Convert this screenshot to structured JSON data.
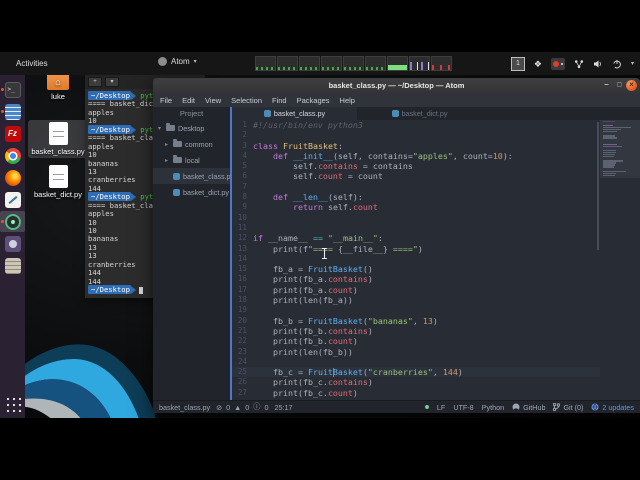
{
  "colors": {
    "accent_pane_blue": "#4d78cc",
    "terminal_prompt_blue": "#2e6db4",
    "terminal_command_green": "#3fd23f",
    "close_button_orange": "#e3571e",
    "dock_running_dot": "#e95420",
    "status_green_dot": "#73c990",
    "updates_blue": "#6494ed",
    "syntax": {
      "comment": "#5c6370",
      "keyword": "#c678dd",
      "class_name": "#e5c07b",
      "function": "#61afef",
      "string": "#98c379",
      "number": "#d19a66",
      "property": "#e06c75",
      "operator": "#56b6c2",
      "text": "#abb2bf"
    }
  },
  "topbar": {
    "activities_label": "Activities",
    "app_menu_label": "Atom",
    "app_menu_caret": "▾",
    "workspace_indicator": "1",
    "dropbox_glyph": "❖",
    "tray_caret": "▾"
  },
  "dock": {
    "items": [
      {
        "name": "terminal",
        "glyph": ">_",
        "running": true,
        "active": false
      },
      {
        "name": "text-editor",
        "glyph": "",
        "running": true,
        "active": false
      },
      {
        "name": "filezilla",
        "glyph": "Fz",
        "running": false,
        "active": false
      },
      {
        "name": "chrome",
        "glyph": "",
        "running": false,
        "active": false
      },
      {
        "name": "firefox",
        "glyph": "",
        "running": false,
        "active": false
      },
      {
        "name": "notes",
        "glyph": "",
        "running": false,
        "active": false
      },
      {
        "name": "atom",
        "glyph": "",
        "running": true,
        "active": true
      },
      {
        "name": "video",
        "glyph": "",
        "running": false,
        "active": false
      },
      {
        "name": "docs",
        "glyph": "",
        "running": false,
        "active": false
      }
    ]
  },
  "desktop_icons": [
    {
      "label": "luke",
      "type": "folder",
      "glyph": "⌂",
      "selected": false
    },
    {
      "label": "basket_class.py",
      "type": "file",
      "glyph": "",
      "selected": true
    },
    {
      "label": "basket_dict.py",
      "type": "file",
      "glyph": "",
      "selected": false
    }
  ],
  "terminal": {
    "new_tab_glyph": "+",
    "dropdown_glyph": "▾",
    "prompt": "~/Desktop",
    "lines": [
      {
        "prompt": true,
        "command": "pyt"
      },
      {
        "output": "==== basket_dict"
      },
      {
        "output": "apples"
      },
      {
        "output": "10"
      },
      {
        "prompt": true,
        "command": "pyt"
      },
      {
        "output": "==== basket_clas"
      },
      {
        "output": "apples"
      },
      {
        "output": "10"
      },
      {
        "output": "bananas"
      },
      {
        "output": "13"
      },
      {
        "output": "cranberries"
      },
      {
        "output": "144"
      },
      {
        "prompt": true,
        "command": "pyt"
      },
      {
        "output": "==== basket_clas"
      },
      {
        "output": "apples"
      },
      {
        "output": "10"
      },
      {
        "output": "10"
      },
      {
        "output": "bananas"
      },
      {
        "output": "13"
      },
      {
        "output": "13"
      },
      {
        "output": "cranberries"
      },
      {
        "output": "144"
      },
      {
        "output": "144"
      },
      {
        "prompt": true,
        "command": "",
        "cursor": true
      }
    ]
  },
  "atom": {
    "window_title": "basket_class.py — ~/Desktop — Atom",
    "minimize_glyph": "–",
    "maximize_glyph": "▢",
    "close_glyph": "×",
    "menus": [
      "File",
      "Edit",
      "View",
      "Selection",
      "Find",
      "Packages",
      "Help"
    ],
    "project": {
      "header": "Project",
      "items": [
        {
          "label": "Desktop",
          "type": "folder",
          "chevron": "▾",
          "indent": 0,
          "selected": false
        },
        {
          "label": "common",
          "type": "folder",
          "chevron": "▸",
          "indent": 1,
          "selected": false
        },
        {
          "label": "local",
          "type": "folder",
          "chevron": "▸",
          "indent": 1,
          "selected": false
        },
        {
          "label": "basket_class.py",
          "type": "python-file",
          "chevron": "",
          "indent": 1,
          "selected": true
        },
        {
          "label": "basket_dict.py",
          "type": "python-file",
          "chevron": "",
          "indent": 1,
          "selected": false
        }
      ]
    },
    "tabs": [
      {
        "label": "basket_class.py",
        "active": true
      },
      {
        "label": "basket_dict.py",
        "active": false
      }
    ],
    "editor": {
      "cursor": {
        "line": 25,
        "column": 17
      },
      "lines": [
        {
          "n": 1,
          "tokens": [
            [
              "c",
              "#!/usr/bin/env python3"
            ]
          ]
        },
        {
          "n": 2,
          "tokens": []
        },
        {
          "n": 3,
          "tokens": [
            [
              "k",
              "class "
            ],
            [
              "cl",
              "FruitBasket"
            ],
            [
              "t",
              ":"
            ]
          ]
        },
        {
          "n": 4,
          "tokens": [
            [
              "t",
              "    "
            ],
            [
              "k",
              "def "
            ],
            [
              "fn",
              "__init__"
            ],
            [
              "t",
              "(self, contains="
            ],
            [
              "s",
              "\"apples\""
            ],
            [
              "t",
              ", count="
            ],
            [
              "n2",
              "10"
            ],
            [
              "t",
              "):"
            ]
          ]
        },
        {
          "n": 5,
          "tokens": [
            [
              "t",
              "        self."
            ],
            [
              "p",
              "contains"
            ],
            [
              "t",
              " = contains"
            ]
          ]
        },
        {
          "n": 6,
          "tokens": [
            [
              "t",
              "        self."
            ],
            [
              "p",
              "count"
            ],
            [
              "t",
              " = count"
            ]
          ]
        },
        {
          "n": 7,
          "tokens": []
        },
        {
          "n": 8,
          "tokens": [
            [
              "t",
              "    "
            ],
            [
              "k",
              "def "
            ],
            [
              "fn",
              "__len__"
            ],
            [
              "t",
              "(self):"
            ]
          ]
        },
        {
          "n": 9,
          "tokens": [
            [
              "t",
              "        "
            ],
            [
              "k",
              "return"
            ],
            [
              "t",
              " self."
            ],
            [
              "p",
              "count"
            ]
          ]
        },
        {
          "n": 10,
          "tokens": []
        },
        {
          "n": 11,
          "tokens": []
        },
        {
          "n": 12,
          "tokens": [
            [
              "k",
              "if "
            ],
            [
              "t",
              "__name__ "
            ],
            [
              "o",
              "=="
            ],
            [
              "t",
              " "
            ],
            [
              "s",
              "\"__main__\""
            ],
            [
              "t",
              ":"
            ]
          ]
        },
        {
          "n": 13,
          "tokens": [
            [
              "t",
              "    print(f"
            ],
            [
              "s",
              "\"==== "
            ],
            [
              "t",
              "{__file__}"
            ],
            [
              "s",
              " ====\""
            ],
            [
              "t",
              ")"
            ]
          ]
        },
        {
          "n": 14,
          "tokens": []
        },
        {
          "n": 15,
          "tokens": [
            [
              "t",
              "    fb_a = "
            ],
            [
              "fn",
              "FruitBasket"
            ],
            [
              "t",
              "()"
            ]
          ]
        },
        {
          "n": 16,
          "tokens": [
            [
              "t",
              "    print(fb_a."
            ],
            [
              "p",
              "contains"
            ],
            [
              "t",
              ")"
            ]
          ]
        },
        {
          "n": 17,
          "tokens": [
            [
              "t",
              "    print(fb_a."
            ],
            [
              "p",
              "count"
            ],
            [
              "t",
              ")"
            ]
          ]
        },
        {
          "n": 18,
          "tokens": [
            [
              "t",
              "    print(len(fb_a))"
            ]
          ]
        },
        {
          "n": 19,
          "tokens": []
        },
        {
          "n": 20,
          "tokens": [
            [
              "t",
              "    fb_b = "
            ],
            [
              "fn",
              "FruitBasket"
            ],
            [
              "t",
              "("
            ],
            [
              "s",
              "\"bananas\""
            ],
            [
              "t",
              ", "
            ],
            [
              "n2",
              "13"
            ],
            [
              "t",
              ")"
            ]
          ]
        },
        {
          "n": 21,
          "tokens": [
            [
              "t",
              "    print(fb_b."
            ],
            [
              "p",
              "contains"
            ],
            [
              "t",
              ")"
            ]
          ]
        },
        {
          "n": 22,
          "tokens": [
            [
              "t",
              "    print(fb_b."
            ],
            [
              "p",
              "count"
            ],
            [
              "t",
              ")"
            ]
          ]
        },
        {
          "n": 23,
          "tokens": [
            [
              "t",
              "    print(len(fb_b))"
            ]
          ]
        },
        {
          "n": 24,
          "tokens": []
        },
        {
          "n": 25,
          "tokens": [
            [
              "t",
              "    fb_c = "
            ],
            [
              "fn",
              "FruitBasket"
            ],
            [
              "t",
              "("
            ],
            [
              "s",
              "\"cranberries\""
            ],
            [
              "t",
              ", "
            ],
            [
              "n2",
              "144"
            ],
            [
              "t",
              ")"
            ]
          ]
        },
        {
          "n": 26,
          "tokens": [
            [
              "t",
              "    print(fb_c."
            ],
            [
              "p",
              "contains"
            ],
            [
              "t",
              ")"
            ]
          ]
        },
        {
          "n": 27,
          "tokens": [
            [
              "t",
              "    print(fb_c."
            ],
            [
              "p",
              "count"
            ],
            [
              "t",
              ")"
            ]
          ]
        }
      ]
    },
    "statusbar": {
      "file": "basket_class.py",
      "errors_icon": "⊘",
      "errors": "0",
      "warnings_icon": "▲",
      "warnings": "0",
      "info_icon": "ⓘ",
      "info": "0",
      "cursor_position": "25:17",
      "line_ending": "LF",
      "encoding": "UTF-8",
      "grammar": "Python",
      "github_label": "GitHub",
      "git_label": "Git (0)",
      "updates_label": "2 updates"
    }
  }
}
